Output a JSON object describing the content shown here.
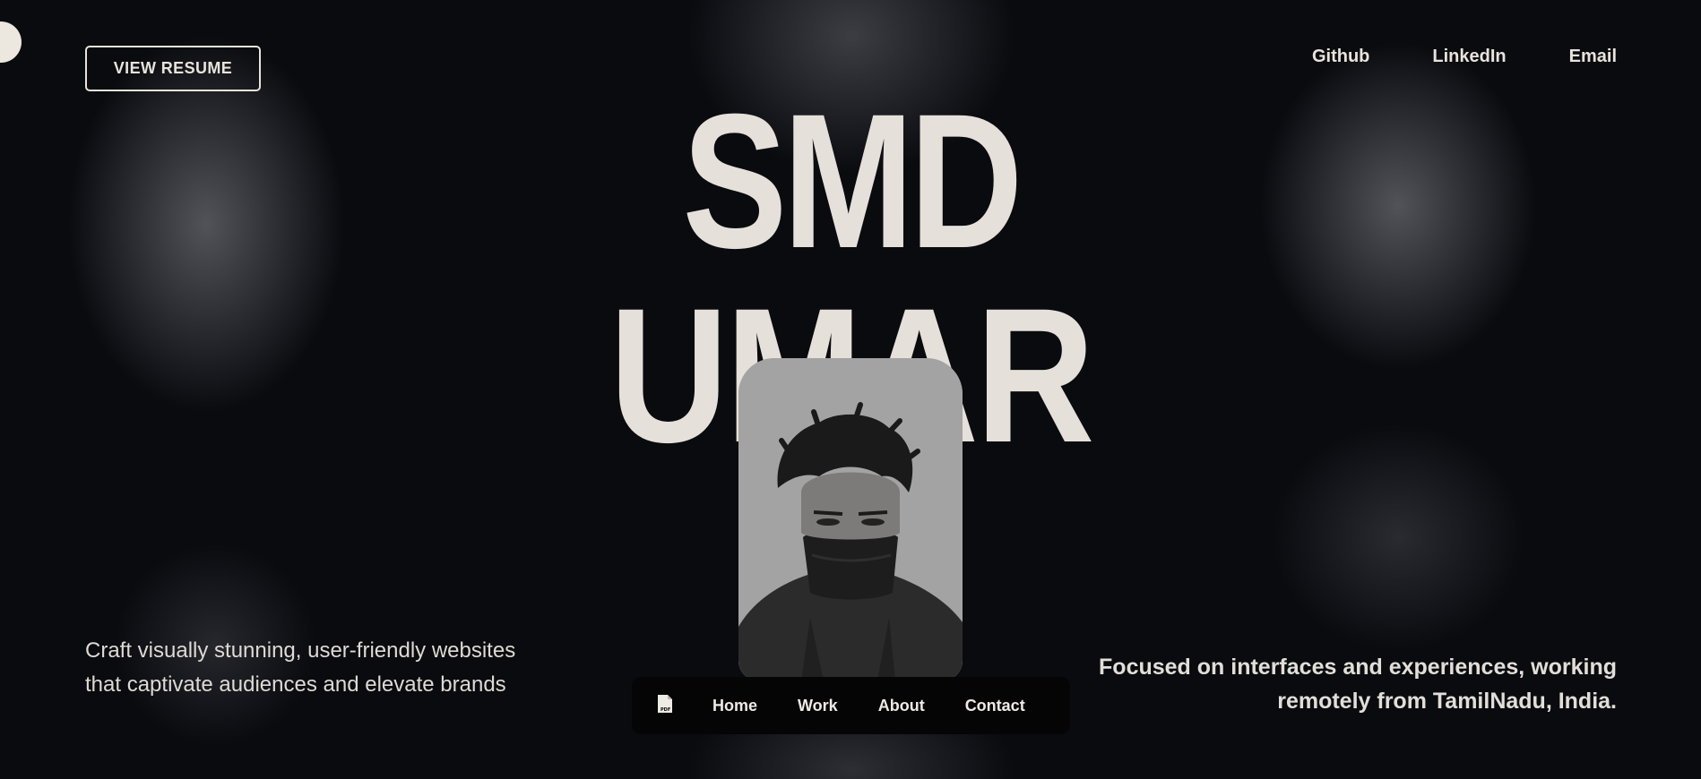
{
  "header": {
    "resume_button": "VIEW RESUME",
    "links": [
      "Github",
      "LinkedIn",
      "Email"
    ]
  },
  "hero": {
    "line1": "SMD",
    "line2": "UMAR"
  },
  "left_tagline": "Craft visually stunning, user-friendly websites that captivate audiences and elevate brands",
  "right_tagline": "Focused on interfaces and experiences, working remotely from TamilNadu, India.",
  "bottom_nav": {
    "pdf_icon": "pdf-file-icon",
    "items": [
      "Home",
      "Work",
      "About",
      "Contact"
    ]
  },
  "colors": {
    "background": "#0a0b0f",
    "text": "#e8e3dc",
    "portrait_bg": "#a3a3a3",
    "nav_bg": "#050506"
  }
}
